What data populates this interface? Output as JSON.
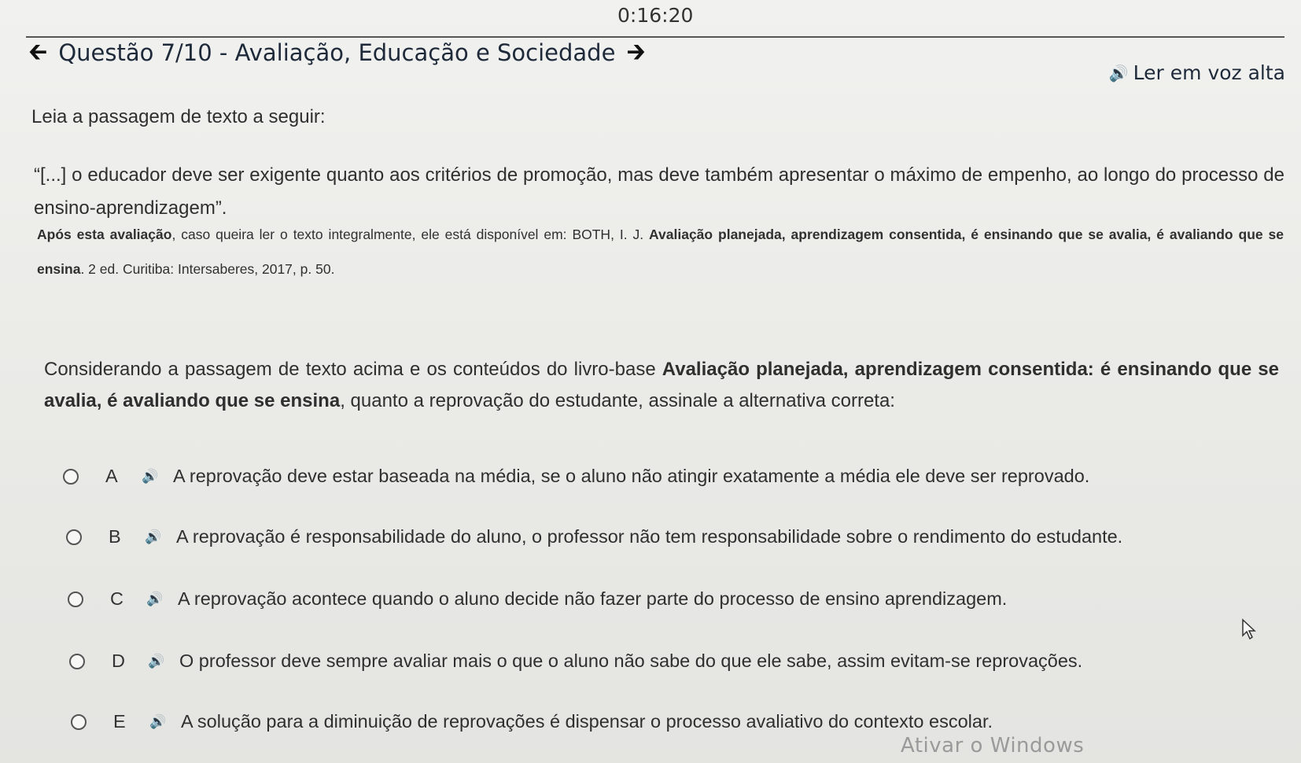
{
  "timer": "0:16:20",
  "header": {
    "prev_icon": "arrow-left-icon",
    "next_icon": "arrow-right-icon",
    "title": "Questão 7/10 - Avaliação, Educação e Sociedade"
  },
  "listen": {
    "icon": "speaker-icon",
    "label": "Ler em voz alta"
  },
  "intro": "Leia a passagem de texto a seguir:",
  "quote": "“[...] o educador deve ser exigente quanto aos critérios de promoção, mas deve também apresentar o máximo de empenho, ao longo do processo de ensino-aprendizagem”.",
  "reference": {
    "lead": "Após esta avaliação",
    "middle": ", caso queira ler o texto integralmente, ele está disponível em: BOTH, I. J. ",
    "book": "Avaliação planejada, aprendizagem consentida, é ensinando que se avalia, é avaliando que se ensina",
    "tail": ". 2 ed. Curitiba: Intersaberes, 2017, p. 50."
  },
  "prompt": {
    "lead": "Considerando a passagem de texto acima e os conteúdos do livro-base ",
    "book": "Avaliação planejada, aprendizagem consentida: é ensinando que se avalia, é avaliando que se ensina",
    "tail": ", quanto a reprovação do estudante, assinale a alternativa correta:"
  },
  "options": [
    {
      "letter": "A",
      "text": "A reprovação deve estar baseada na média, se o aluno não atingir exatamente a média ele deve ser reprovado."
    },
    {
      "letter": "B",
      "text": "A reprovação é responsabilidade do aluno, o professor não tem responsabilidade sobre o rendimento do estudante."
    },
    {
      "letter": "C",
      "text": "A reprovação acontece quando o aluno decide não fazer parte do processo de ensino aprendizagem."
    },
    {
      "letter": "D",
      "text": "O professor deve sempre avaliar mais o que o aluno não sabe do que ele sabe, assim evitam-se reprovações."
    },
    {
      "letter": "E",
      "text": "A solução para a diminuição de reprovações é dispensar o processo avaliativo do contexto escolar."
    }
  ],
  "watermark": "Ativar o Windows"
}
